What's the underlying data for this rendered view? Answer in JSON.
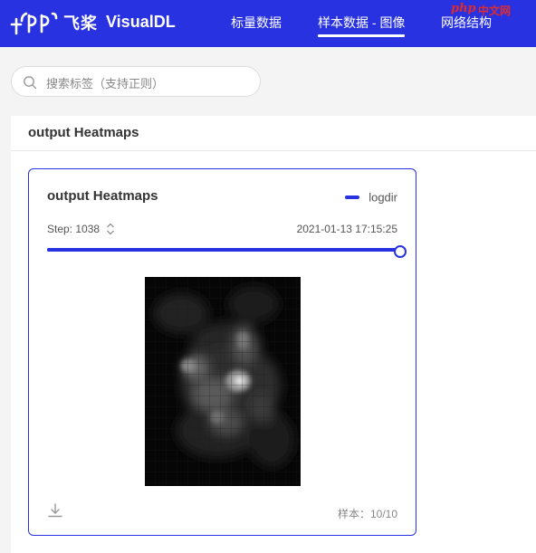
{
  "header": {
    "logo_text": "飞桨",
    "app_name": "VisualDL",
    "nav": [
      {
        "label": "标量数据",
        "active": false
      },
      {
        "label": "样本数据 - 图像",
        "active": true
      },
      {
        "label": "网络结构",
        "active": false
      }
    ],
    "watermark_php": "php",
    "watermark_cn": "中文网",
    "brand_color": "#2932e1"
  },
  "search": {
    "placeholder": "搜索标签（支持正则）",
    "value": ""
  },
  "section": {
    "title": "output Heatmaps"
  },
  "card": {
    "title": "output Heatmaps",
    "legend_label": "logdir",
    "step_label": "Step: 1038",
    "timestamp": "2021-01-13 17:15:25",
    "slider_progress": 1.0,
    "sample_count": "样本：10/10",
    "icons": {
      "step_toggle": "chevron-up-down-icon",
      "download": "download-icon"
    }
  }
}
